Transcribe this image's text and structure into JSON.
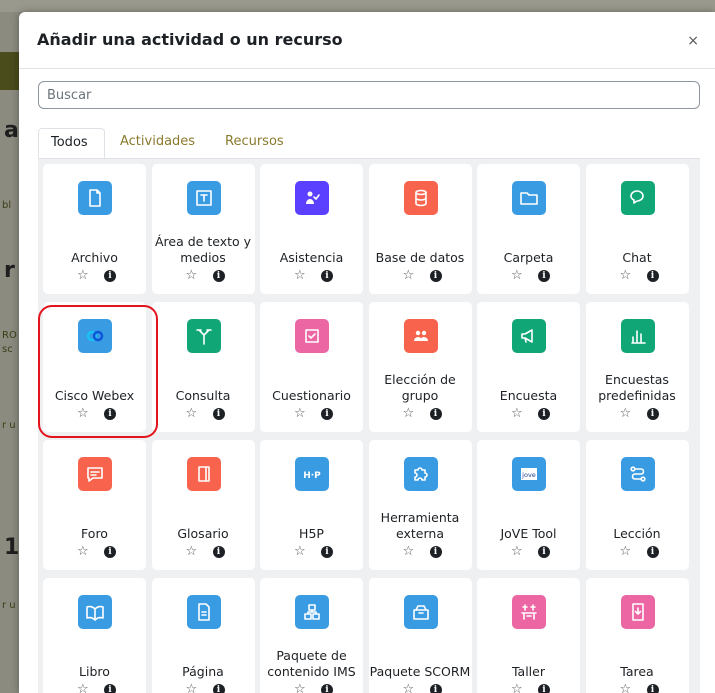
{
  "modal": {
    "title": "Añadir una actividad o un recurso",
    "close_label": "×",
    "search_placeholder": "Buscar",
    "tabs": [
      {
        "label": "Todos",
        "active": true
      },
      {
        "label": "Actividades",
        "active": false
      },
      {
        "label": "Recursos",
        "active": false
      }
    ],
    "star_glyph": "☆",
    "info_glyph": "i",
    "items": [
      {
        "label": "Archivo",
        "icon": "file-icon",
        "color": "#399be2"
      },
      {
        "label": "Área de texto y medios",
        "icon": "text-area-icon",
        "color": "#399be2"
      },
      {
        "label": "Asistencia",
        "icon": "attendance-icon",
        "color": "#5b40ff"
      },
      {
        "label": "Base de datos",
        "icon": "database-icon",
        "color": "#f7634d"
      },
      {
        "label": "Carpeta",
        "icon": "folder-icon",
        "color": "#399be2"
      },
      {
        "label": "Chat",
        "icon": "chat-icon",
        "color": "#11a676"
      },
      {
        "label": "Cisco Webex",
        "icon": "webex-icon",
        "color": "#399be2"
      },
      {
        "label": "Consulta",
        "icon": "choice-icon",
        "color": "#11a676"
      },
      {
        "label": "Cuestionario",
        "icon": "quiz-icon",
        "color": "#eb66a2"
      },
      {
        "label": "Elección de grupo",
        "icon": "group-choice-icon",
        "color": "#f7634d"
      },
      {
        "label": "Encuesta",
        "icon": "megaphone-icon",
        "color": "#11a676"
      },
      {
        "label": "Encuestas predefinidas",
        "icon": "bar-chart-icon",
        "color": "#11a676"
      },
      {
        "label": "Foro",
        "icon": "forum-icon",
        "color": "#f7634d"
      },
      {
        "label": "Glosario",
        "icon": "glossary-icon",
        "color": "#f7634d"
      },
      {
        "label": "H5P",
        "icon": "h5p-icon",
        "color": "#399be2"
      },
      {
        "label": "Herramienta externa",
        "icon": "puzzle-icon",
        "color": "#399be2"
      },
      {
        "label": "JoVE Tool",
        "icon": "jove-icon",
        "color": "#399be2"
      },
      {
        "label": "Lección",
        "icon": "lesson-icon",
        "color": "#399be2"
      },
      {
        "label": "Libro",
        "icon": "book-icon",
        "color": "#399be2"
      },
      {
        "label": "Página",
        "icon": "page-icon",
        "color": "#399be2"
      },
      {
        "label": "Paquete de contenido IMS",
        "icon": "ims-package-icon",
        "color": "#399be2"
      },
      {
        "label": "Paquete SCORM",
        "icon": "scorm-icon",
        "color": "#399be2"
      },
      {
        "label": "Taller",
        "icon": "workshop-icon",
        "color": "#eb66a2"
      },
      {
        "label": "Tarea",
        "icon": "assignment-icon",
        "color": "#eb66a2"
      }
    ]
  },
  "background": {
    "letters": [
      "a",
      "r",
      "1"
    ],
    "fragments": [
      "bl",
      "RO",
      "sc",
      "r u",
      "r u"
    ]
  }
}
